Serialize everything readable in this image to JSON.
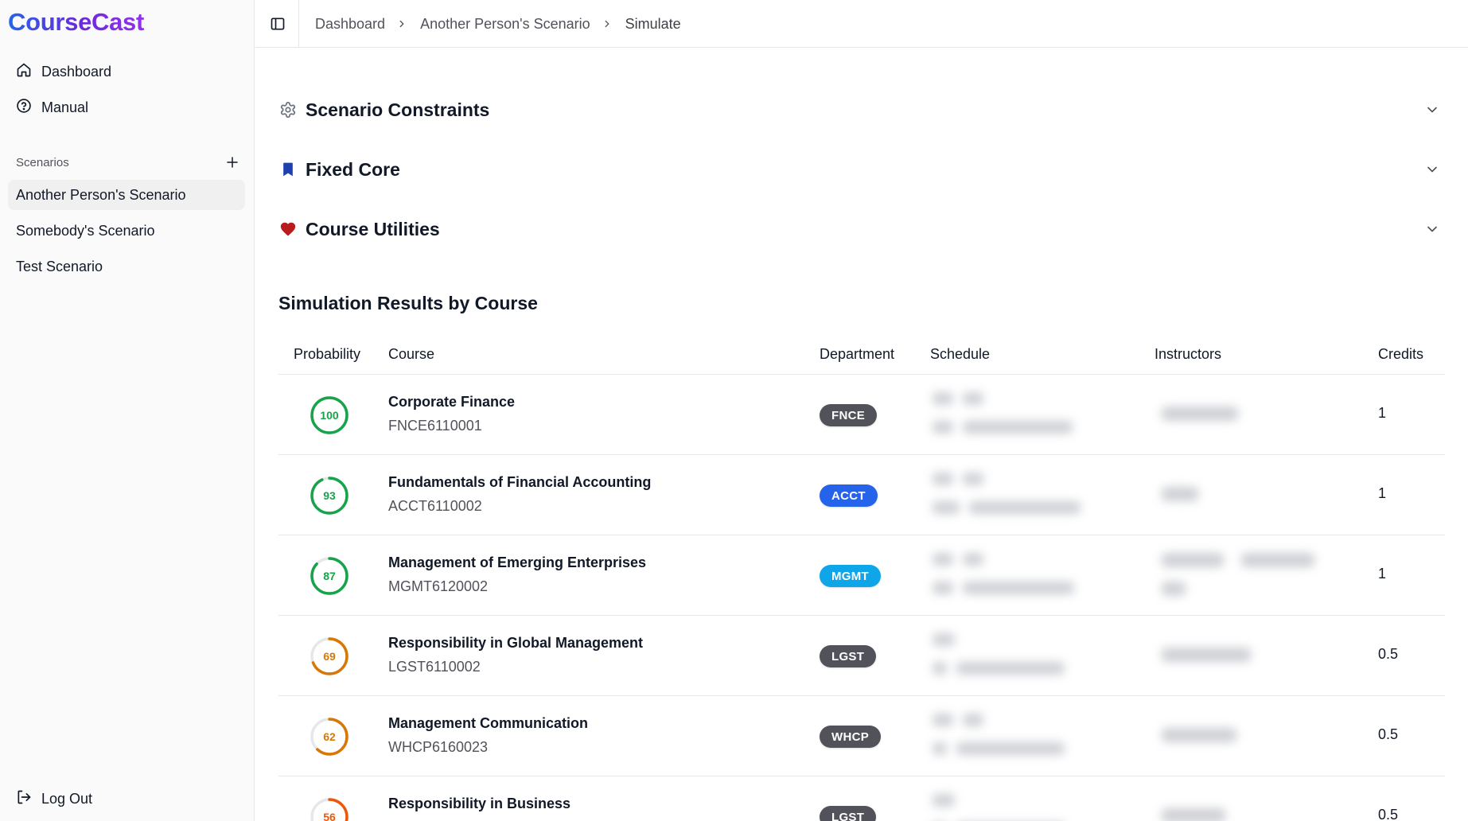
{
  "app": {
    "name": "CourseCast"
  },
  "sidebar": {
    "nav": [
      {
        "label": "Dashboard",
        "icon": "home-icon"
      },
      {
        "label": "Manual",
        "icon": "help-circle-icon"
      }
    ],
    "scenarios_label": "Scenarios",
    "scenarios": [
      {
        "label": "Another Person's Scenario",
        "active": true
      },
      {
        "label": "Somebody's Scenario",
        "active": false
      },
      {
        "label": "Test Scenario",
        "active": false
      }
    ],
    "logout_label": "Log Out"
  },
  "header": {
    "breadcrumbs": [
      "Dashboard",
      "Another Person's Scenario",
      "Simulate"
    ]
  },
  "sections": [
    {
      "title": "Scenario Constraints",
      "icon": "gear-icon",
      "expanded": false
    },
    {
      "title": "Fixed Core",
      "icon": "bookmark-icon",
      "expanded": false
    },
    {
      "title": "Course Utilities",
      "icon": "heart-icon",
      "expanded": false
    }
  ],
  "results": {
    "title": "Simulation Results by Course",
    "columns": {
      "probability": "Probability",
      "course": "Course",
      "department": "Department",
      "schedule": "Schedule",
      "instructors": "Instructors",
      "credits": "Credits"
    },
    "rows": [
      {
        "probability": "100",
        "name": "Corporate Finance",
        "code": "FNCE6110001",
        "dept": "FNCE",
        "credits": "1"
      },
      {
        "probability": "93",
        "name": "Fundamentals of Financial Accounting",
        "code": "ACCT6110002",
        "dept": "ACCT",
        "credits": "1"
      },
      {
        "probability": "87",
        "name": "Management of Emerging Enterprises",
        "code": "MGMT6120002",
        "dept": "MGMT",
        "credits": "1"
      },
      {
        "probability": "69",
        "name": "Responsibility in Global Management",
        "code": "LGST6110002",
        "dept": "LGST",
        "credits": "0.5"
      },
      {
        "probability": "62",
        "name": "Management Communication",
        "code": "WHCP6160023",
        "dept": "WHCP",
        "credits": "0.5"
      },
      {
        "probability": "56",
        "name": "Responsibility in Business",
        "code": "",
        "dept": "LGST",
        "credits": "0.5"
      }
    ]
  },
  "colors": {
    "brand_start": "#2563eb",
    "brand_end": "#9333ea",
    "prob_high": "#16a34a",
    "prob_mid": "#d97706",
    "prob_low": "#ea580c",
    "dept_FNCE": "#52525b",
    "dept_ACCT": "#2563eb",
    "dept_MGMT": "#0ea5e9",
    "dept_LGST": "#52525b",
    "dept_WHCP": "#52525b",
    "bookmark": "#1e40af",
    "heart": "#b91c1c"
  }
}
